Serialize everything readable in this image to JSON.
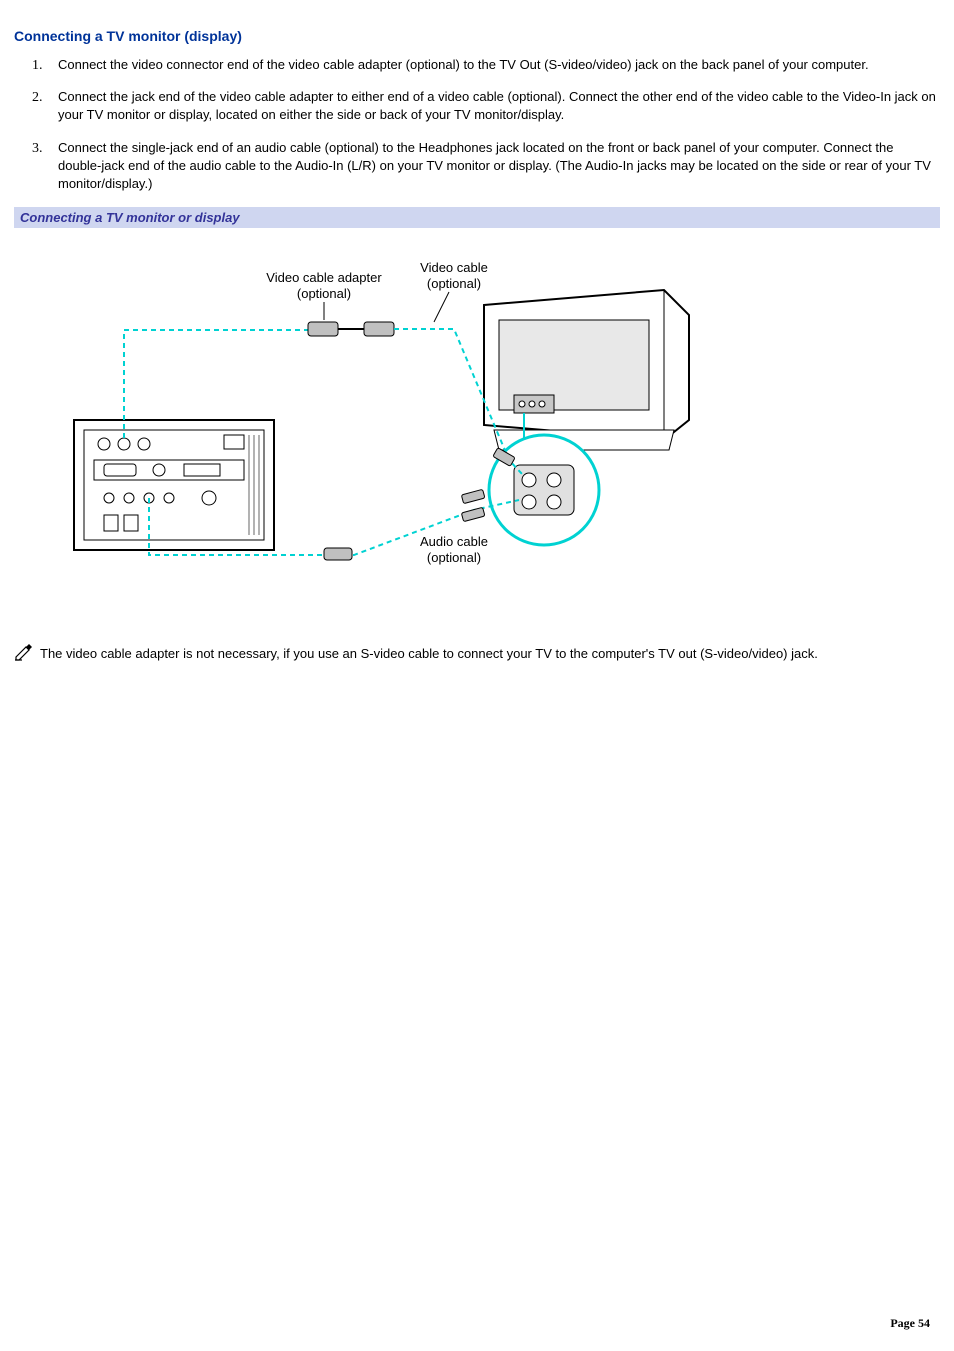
{
  "heading": "Connecting a TV monitor (display)",
  "steps": [
    "Connect the video connector end of the video cable adapter (optional) to the TV Out (S-video/video) jack on the back panel of your computer.",
    "Connect the jack end of the video cable adapter to either end of a video cable (optional). Connect the other end of the video cable to the Video-In jack on your TV monitor or display, located on either the side or back of your TV monitor/display.",
    "Connect the single-jack end of an audio cable (optional) to the Headphones jack located on the front or back panel of your computer. Connect the double-jack end of the audio cable to the Audio-In (L/R) on your TV monitor or display. (The Audio-In jacks may be located on the side or rear of your TV monitor/display.)"
  ],
  "figure": {
    "caption": "Connecting a TV monitor or display",
    "labels": {
      "video_cable_adapter_l1": "Video cable adapter",
      "video_cable_adapter_l2": "(optional)",
      "video_cable_l1": "Video cable",
      "video_cable_l2": "(optional)",
      "audio_cable_l1": "Audio cable",
      "audio_cable_l2": "(optional)"
    }
  },
  "note": "The video cable adapter is not necessary, if you use an S-video cable to connect your TV to the computer's TV out (S-video/video) jack.",
  "footer": {
    "page_label": "Page",
    "page_number": "54"
  }
}
